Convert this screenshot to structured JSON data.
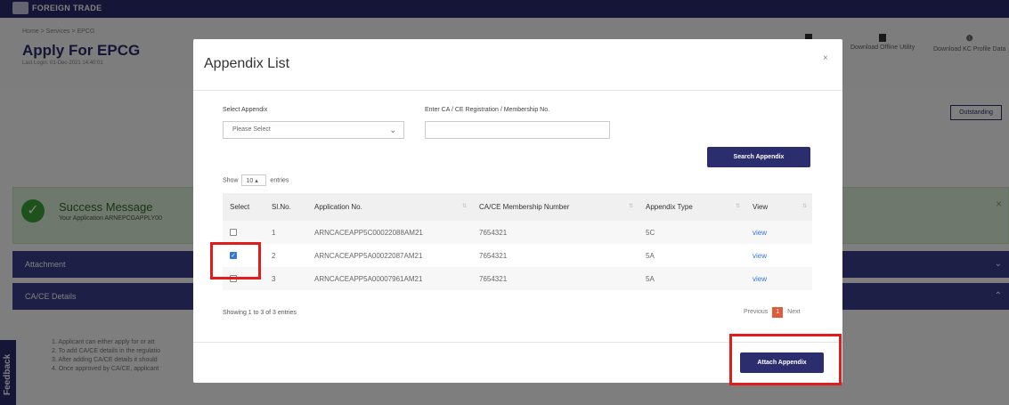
{
  "header": {
    "brand": "FOREIGN TRADE",
    "breadcrumb": "Home > Services > EPCG",
    "page_title": "Apply For EPCG",
    "last_login": "Last Login: 01-Dec-2021 14:40:01",
    "tools": [
      {
        "label": "",
        "icon": "download-icon"
      },
      {
        "label": "Download Offline Utility",
        "icon": "download-icon"
      },
      {
        "label": "Download KC Profile Data",
        "icon": "info-icon"
      }
    ],
    "outstanding_label": "Outstanding"
  },
  "success": {
    "title": "Success Message",
    "text": "Your Application ARNEPCGAPPLY00",
    "close": "×"
  },
  "sections": {
    "attachment": "Attachment",
    "cace_details": "CA/CE Details"
  },
  "notes": [
    "1. Applicant can either apply for or att",
    "2. To add CA/CE details in the regulatio",
    "3. After adding CA/CE details it should",
    "4. Once approved by CA/CE, applicant"
  ],
  "feedback_label": "Feedback",
  "modal": {
    "title": "Appendix List",
    "close": "×",
    "select_label": "Select Appendix",
    "select_value": "Please Select",
    "membership_label": "Enter CA / CE Registration / Membership No.",
    "membership_value": "",
    "search_button": "Search Appendix",
    "show_prefix": "Show",
    "show_value": "10",
    "show_suffix": "entries",
    "columns": [
      "Select",
      "Sl.No.",
      "Application No.",
      "CA/CE Membership Number",
      "Appendix Type",
      "View"
    ],
    "rows": [
      {
        "checked": false,
        "sl": "1",
        "app_no": "ARNCACEAPP5C00022088AM21",
        "membership": "7654321",
        "type": "5C",
        "view": "view"
      },
      {
        "checked": true,
        "sl": "2",
        "app_no": "ARNCACEAPP5A00022087AM21",
        "membership": "7654321",
        "type": "5A",
        "view": "view"
      },
      {
        "checked": false,
        "sl": "3",
        "app_no": "ARNCACEAPP5A00007961AM21",
        "membership": "7654321",
        "type": "5A",
        "view": "view"
      }
    ],
    "showing_text": "Showing 1 to 3 of 3 entries",
    "pager": {
      "previous": "Previous",
      "current": "1",
      "next": "Next"
    },
    "attach_button": "Attach Appendix"
  },
  "colors": {
    "accent": "#2b2d6e",
    "highlight": "#e21b1b",
    "success_bg": "#dff0d8",
    "link": "#3478d6"
  }
}
